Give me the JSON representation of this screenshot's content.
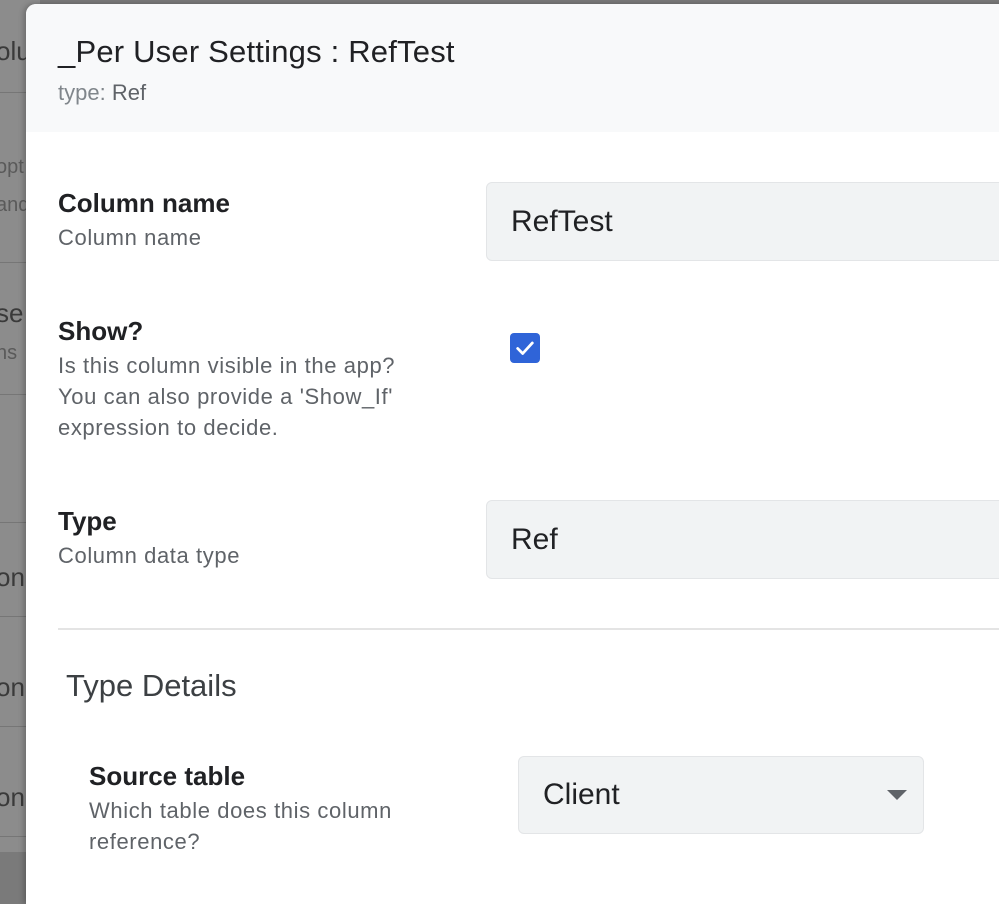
{
  "background": {
    "fragments": [
      "olu",
      "opt",
      "and",
      "se",
      "ns",
      "on",
      "on",
      "on"
    ]
  },
  "dialog": {
    "title": "_Per User Settings : RefTest",
    "subtitle_label": "type:",
    "subtitle_value": "Ref"
  },
  "fields": {
    "column_name": {
      "label": "Column name",
      "help": "Column name",
      "value": "RefTest"
    },
    "show": {
      "label": "Show?",
      "help_lines": [
        "Is this column visible in the app?",
        "You can also provide a 'Show_If'",
        "expression to decide."
      ],
      "checked": true
    },
    "type": {
      "label": "Type",
      "help": "Column data type",
      "value": "Ref"
    }
  },
  "type_details": {
    "title": "Type Details",
    "source_table": {
      "label": "Source table",
      "help_lines": [
        "Which table does this column",
        "reference?"
      ],
      "value": "Client"
    }
  },
  "colors": {
    "checkbox": "#2f64d8",
    "header_bg": "#f8f9fa",
    "field_bg": "#f1f3f4"
  },
  "icons": {
    "checkbox": "check-icon",
    "dropdown": "chevron-down-icon"
  }
}
